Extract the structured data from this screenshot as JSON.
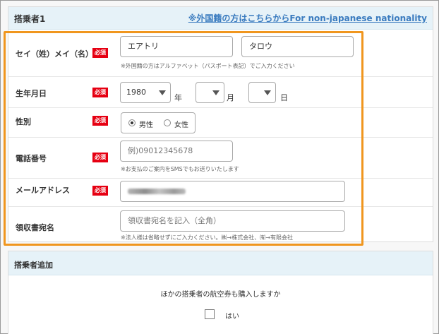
{
  "passenger": {
    "title": "搭乗者1",
    "foreign_link": "※外国籍の方はこちらからFor non-japanese nationality",
    "required_badge": "必須",
    "name": {
      "label": "セイ（姓）メイ（名）",
      "sei_value": "エアトリ",
      "mei_value": "タロウ",
      "note": "※外国籍の方はアルファベット（パスポート表記）でご入力ください"
    },
    "birth": {
      "label": "生年月日",
      "year_value": "1980",
      "year_unit": "年",
      "month_value": "",
      "month_unit": "月",
      "day_value": "",
      "day_unit": "日"
    },
    "gender": {
      "label": "性別",
      "male": "男性",
      "female": "女性",
      "selected": "男性"
    },
    "phone": {
      "label": "電話番号",
      "placeholder": "例)09012345678",
      "note": "※お支払のご案内をSMSでもお送りいたします"
    },
    "email": {
      "label": "メールアドレス"
    },
    "receipt": {
      "label": "領収書宛名",
      "placeholder": "領収書宛名を記入（全角）",
      "note": "※法人様は省略せずにご入力ください。㈱→株式会社、㈲→有限会社"
    }
  },
  "add_passenger": {
    "title": "搭乗者追加",
    "question": "ほかの搭乗者の航空券も購入しますか",
    "checkbox_label": "はい"
  },
  "colors": {
    "header_bg": "#e6f2f8",
    "required_red": "#e60012",
    "highlight_orange": "#f0961e",
    "link_blue": "#3a7bbf"
  }
}
